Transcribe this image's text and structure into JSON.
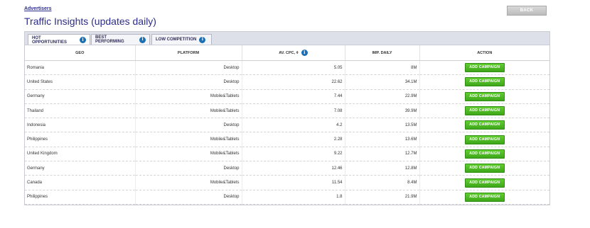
{
  "breadcrumb": "Advertisers",
  "title": "Traffic Insights (updates daily)",
  "back_label": "BACK",
  "tabs": [
    {
      "label": "HOT OPPORTUNITIES",
      "active": true
    },
    {
      "label": "BEST PERFORMING",
      "active": false
    },
    {
      "label": "LOW COMPETITION",
      "active": false
    }
  ],
  "table": {
    "headers": {
      "geo": "GEO",
      "platform": "PLATFORM",
      "cpc": "AV. CPC, ¢",
      "imp": "IMP. DAILY",
      "action": "ACTION"
    },
    "action_label": "ADD CAMPAIGN",
    "rows": [
      {
        "geo": "Romania",
        "platform": "Desktop",
        "cpc": "5.05",
        "imp": "8M"
      },
      {
        "geo": "United States",
        "platform": "Desktop",
        "cpc": "22.62",
        "imp": "34.1M"
      },
      {
        "geo": "Germany",
        "platform": "Mobile&Tablets",
        "cpc": "7.44",
        "imp": "22.9M"
      },
      {
        "geo": "Thailand",
        "platform": "Mobile&Tablets",
        "cpc": "7.08",
        "imp": "39.9M"
      },
      {
        "geo": "Indonesia",
        "platform": "Desktop",
        "cpc": "4.2",
        "imp": "13.5M"
      },
      {
        "geo": "Philippines",
        "platform": "Mobile&Tablets",
        "cpc": "2.28",
        "imp": "13.6M"
      },
      {
        "geo": "United Kingdom",
        "platform": "Mobile&Tablets",
        "cpc": "9.22",
        "imp": "12.7M"
      },
      {
        "geo": "Germany",
        "platform": "Desktop",
        "cpc": "12.46",
        "imp": "12.8M"
      },
      {
        "geo": "Canada",
        "platform": "Mobile&Tablets",
        "cpc": "11.54",
        "imp": "8.4M"
      },
      {
        "geo": "Philippines",
        "platform": "Desktop",
        "cpc": "1.8",
        "imp": "21.9M"
      }
    ]
  },
  "colors": {
    "title": "#2d2d8a",
    "add_button": "#4cb822",
    "info_icon": "#1b6fb5"
  }
}
